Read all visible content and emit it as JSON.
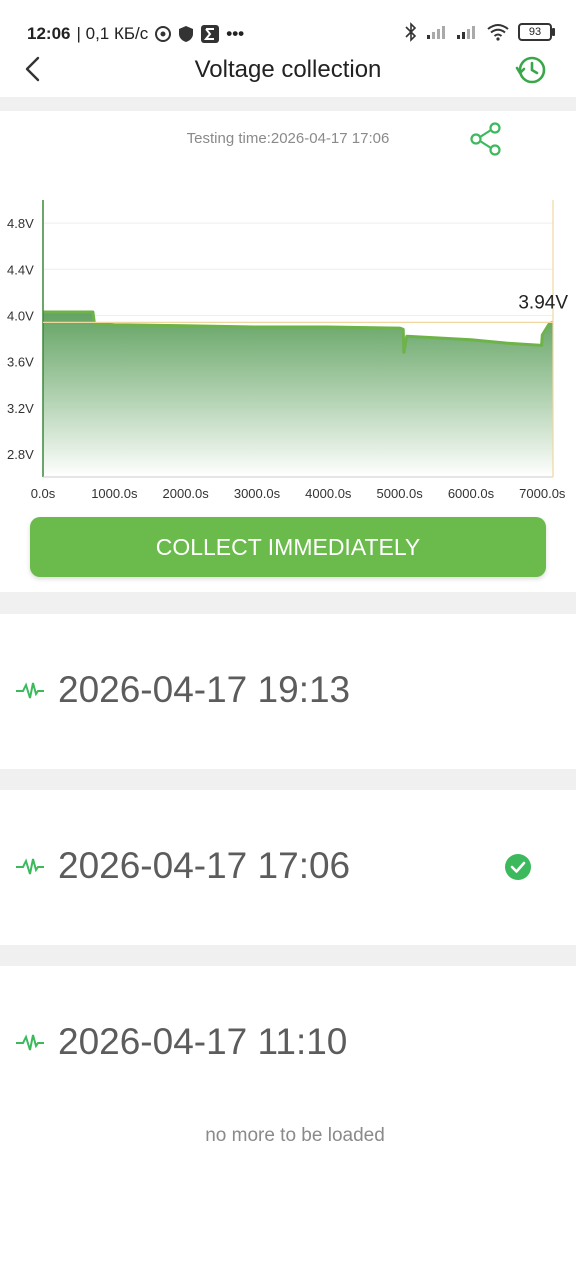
{
  "status_bar": {
    "time": "12:06",
    "speed": "| 0,1 КБ/с",
    "more": "•••",
    "battery": "93"
  },
  "header": {
    "title": "Voltage collection",
    "icons": [
      "back-arrow-icon",
      "history-timer-icon"
    ]
  },
  "test": {
    "testing_time": "Testing time:2026-04-17 17:06"
  },
  "chart_data": {
    "type": "area",
    "current_value_label": "3.94V",
    "x_tick_labels": [
      "0.0s",
      "1000.0s",
      "2000.0s",
      "3000.0s",
      "4000.0s",
      "5000.0s",
      "6000.0s",
      "7000.0s"
    ],
    "y_tick_labels": [
      "2.8V",
      "3.2V",
      "3.6V",
      "4.0V",
      "4.4V",
      "4.8V"
    ],
    "xlim": [
      0,
      7150
    ],
    "ylim": [
      2.6,
      5.0
    ],
    "x_unit": "s",
    "y_unit": "V",
    "series": [
      {
        "x": [
          0,
          700,
          720,
          1000,
          2000,
          3000,
          4000,
          5000,
          5050,
          5060,
          5100,
          6000,
          6500,
          6990,
          7000,
          7100,
          7150
        ],
        "y": [
          4.03,
          4.03,
          3.93,
          3.92,
          3.91,
          3.9,
          3.9,
          3.89,
          3.88,
          3.68,
          3.82,
          3.79,
          3.76,
          3.74,
          3.83,
          3.93,
          3.94
        ]
      }
    ],
    "colors": {
      "line": "#6db34a",
      "fill_top": "#5a9e5a",
      "fill_bottom": "#ffffff",
      "crosshair": "#f0d7a0"
    }
  },
  "actions": {
    "collect_label": "COLLECT IMMEDIATELY"
  },
  "records": [
    {
      "date": "2026-04-17 19:13",
      "selected": false
    },
    {
      "date": "2026-04-17 17:06",
      "selected": true
    },
    {
      "date": "2026-04-17 11:10",
      "selected": false
    }
  ],
  "footer": {
    "no_more": "no more to be loaded"
  },
  "colors": {
    "accent": "#6abb4b",
    "check": "#3cb95c"
  }
}
